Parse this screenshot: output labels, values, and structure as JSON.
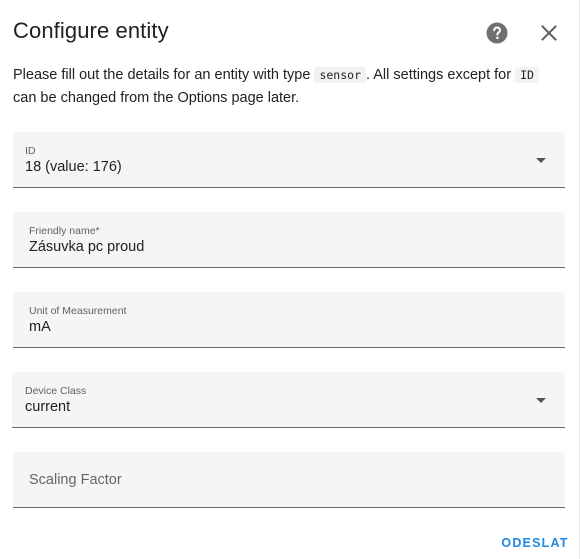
{
  "dialog": {
    "title": "Configure entity",
    "help_icon": "help-circle-icon",
    "close_icon": "close-icon"
  },
  "description": {
    "part1": "Please fill out the details for an entity with type ",
    "type_code": "sensor",
    "part2": ". All settings except for ",
    "id_code": "ID",
    "part3": " can be changed from the Options page later."
  },
  "fields": {
    "id": {
      "label": "ID",
      "value": "18 (value: 176)"
    },
    "friendly_name": {
      "label": "Friendly name*",
      "value": "Zásuvka pc proud"
    },
    "unit": {
      "label": "Unit of Measurement",
      "value": "mA"
    },
    "device_class": {
      "label": "Device Class",
      "value": "current"
    },
    "scaling_factor": {
      "placeholder": "Scaling Factor"
    }
  },
  "actions": {
    "submit_label": "ODESLAT"
  },
  "colors": {
    "accent": "#1e88e5",
    "field_bg": "#f5f5f5"
  }
}
